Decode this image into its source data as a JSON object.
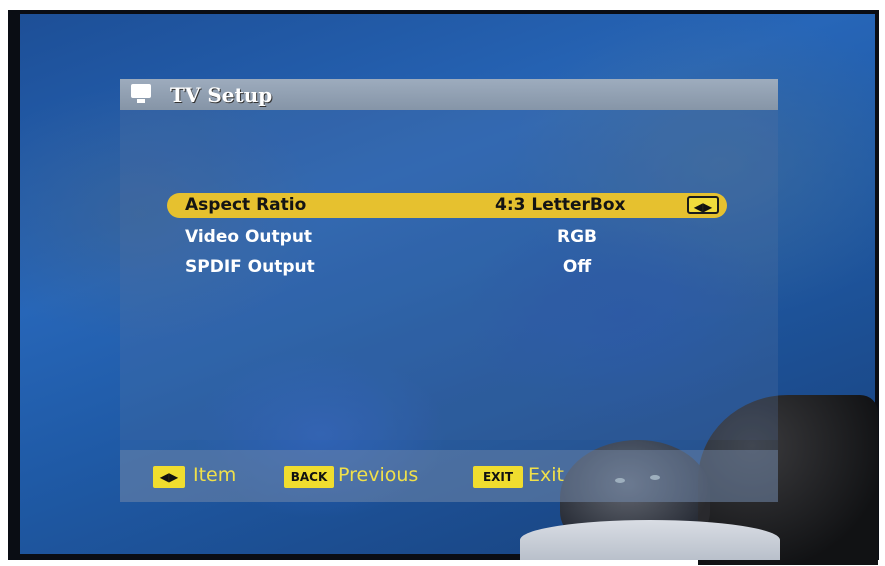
{
  "menu": {
    "title": "TV Setup",
    "items": [
      {
        "label": "Aspect Ratio",
        "value": "4:3 LetterBox",
        "selected": true
      },
      {
        "label": "Video Output",
        "value": "RGB",
        "selected": false
      },
      {
        "label": "SPDIF Output",
        "value": "Off",
        "selected": false
      }
    ]
  },
  "footer": {
    "item_key": "◀▶",
    "item_label": "Item",
    "back_key": "BACK",
    "back_label": "Previous",
    "exit_key": "EXIT",
    "exit_label": "Exit"
  },
  "icons": {
    "title": "tv-icon",
    "selector": "left-right-arrows-icon"
  },
  "colors": {
    "highlight": "#e6c12f",
    "key_yellow": "#f0dd2e",
    "footer_text": "#f0e04a"
  }
}
